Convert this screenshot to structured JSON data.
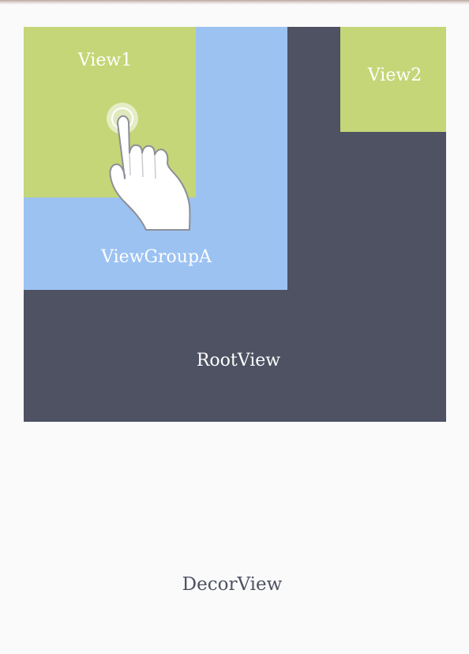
{
  "colors": {
    "decor_background": "#fafafa",
    "root_view": "#4e5263",
    "viewgroup_a": "#9cc2f2",
    "view": "#c4d677",
    "label_light": "#ffffff",
    "label_dark": "#4e5263"
  },
  "views": {
    "root": "RootView",
    "viewgroup_a": "ViewGroupA",
    "view1": "View1",
    "view2": "View2",
    "decor": "DecorView"
  },
  "touch_indicator_icon": "hand-pointer-icon"
}
